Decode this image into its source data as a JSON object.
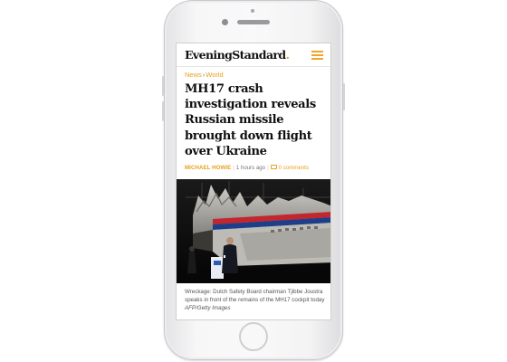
{
  "site": {
    "logo_text": "EveningStandard",
    "logo_dot": "."
  },
  "breadcrumb": {
    "section": "News",
    "separator": "›",
    "subsection": "World"
  },
  "article": {
    "headline": "MH17 crash investigation reveals Russian missile brought down flight over Ukraine",
    "author": "MICHAEL HOWIE",
    "divider": "|",
    "time_ago": "1 hours ago",
    "comments_label": "0  comments"
  },
  "photo": {
    "caption_text": "Wreckage: Dutch Safety Board chairman Tjibbe Joustra speaks in front of the remains of the MH17 cockpit today ",
    "caption_credit": "AFP/Getty Images"
  },
  "colors": {
    "accent": "#e8a01c",
    "headline": "#111111",
    "body_text": "#555555"
  },
  "icons": {
    "menu": "hamburger-icon",
    "comments": "comment-bubble-icon"
  }
}
